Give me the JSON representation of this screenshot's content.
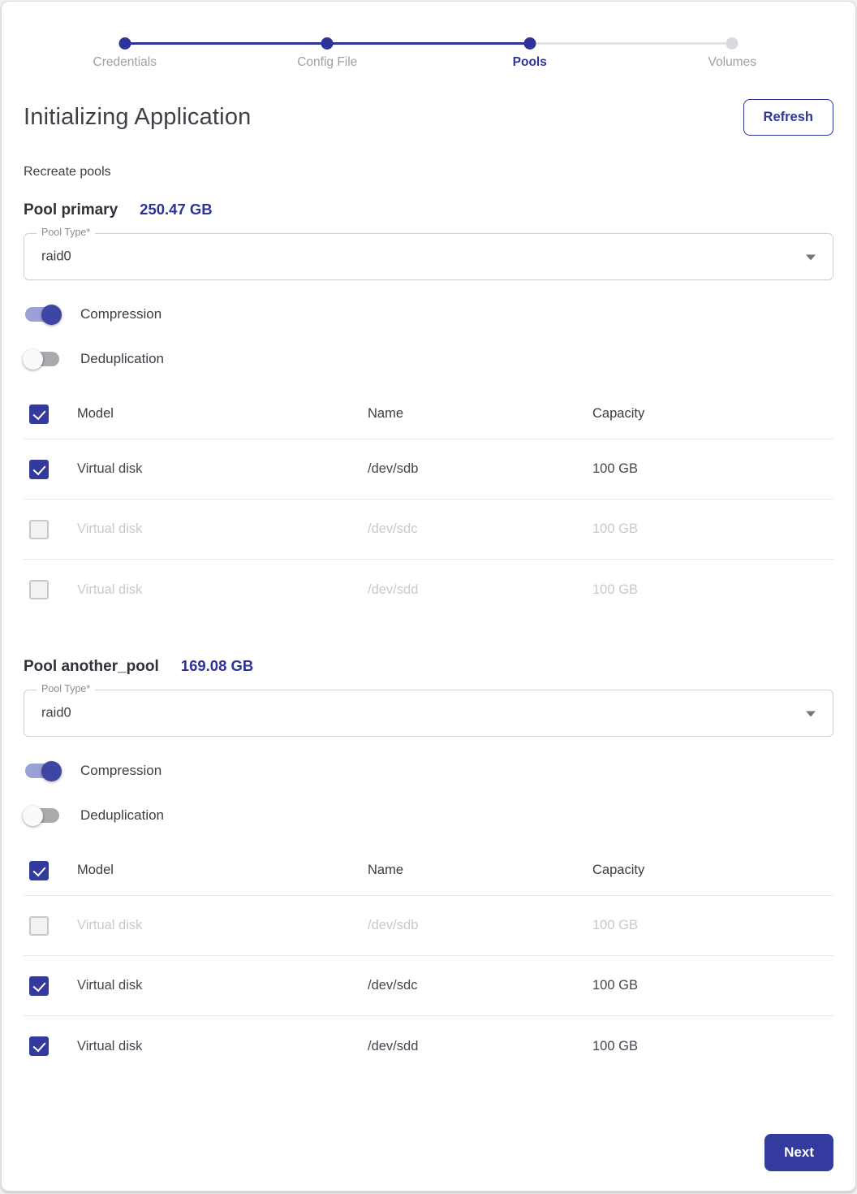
{
  "stepper": {
    "steps": [
      {
        "label": "Credentials",
        "state": "completed"
      },
      {
        "label": "Config File",
        "state": "completed"
      },
      {
        "label": "Pools",
        "state": "active"
      },
      {
        "label": "Volumes",
        "state": "upcoming"
      }
    ]
  },
  "header": {
    "title": "Initializing Application",
    "refresh_label": "Refresh"
  },
  "subtitle": "Recreate pools",
  "table_headers": {
    "model": "Model",
    "name": "Name",
    "capacity": "Capacity"
  },
  "pools": [
    {
      "name_label": "Pool primary",
      "size": "250.47 GB",
      "pool_type_label": "Pool Type*",
      "pool_type_value": "raid0",
      "compression_label": "Compression",
      "compression_on": true,
      "deduplication_label": "Deduplication",
      "deduplication_on": false,
      "header_checked": true,
      "disks": [
        {
          "model": "Virtual disk",
          "name": "/dev/sdb",
          "capacity": "100 GB",
          "checked": true
        },
        {
          "model": "Virtual disk",
          "name": "/dev/sdc",
          "capacity": "100 GB",
          "checked": false
        },
        {
          "model": "Virtual disk",
          "name": "/dev/sdd",
          "capacity": "100 GB",
          "checked": false
        }
      ]
    },
    {
      "name_label": "Pool another_pool",
      "size": "169.08 GB",
      "pool_type_label": "Pool Type*",
      "pool_type_value": "raid0",
      "compression_label": "Compression",
      "compression_on": true,
      "deduplication_label": "Deduplication",
      "deduplication_on": false,
      "header_checked": true,
      "disks": [
        {
          "model": "Virtual disk",
          "name": "/dev/sdb",
          "capacity": "100 GB",
          "checked": false
        },
        {
          "model": "Virtual disk",
          "name": "/dev/sdc",
          "capacity": "100 GB",
          "checked": true
        },
        {
          "model": "Virtual disk",
          "name": "/dev/sdd",
          "capacity": "100 GB",
          "checked": true
        }
      ]
    }
  ],
  "footer": {
    "next_label": "Next"
  },
  "colors": {
    "primary": "#2f3699",
    "toggle_on_track": "#9ba1d6",
    "toggle_on_thumb": "#3d45a5",
    "disabled_text": "#c9c9cc"
  }
}
